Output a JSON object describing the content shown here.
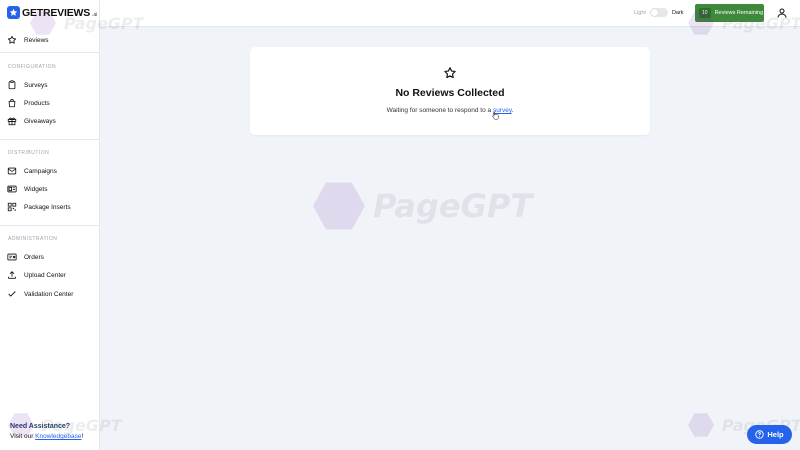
{
  "brand": {
    "name": "GETREVIEWS",
    "suffix": ".ai"
  },
  "sidebar": {
    "top_item": {
      "label": "Reviews",
      "icon": "star-icon"
    },
    "sections": [
      {
        "label": "CONFIGURATION",
        "items": [
          {
            "label": "Surveys",
            "icon": "clipboard-icon"
          },
          {
            "label": "Products",
            "icon": "shopping-bag-icon"
          },
          {
            "label": "Giveaways",
            "icon": "gift-icon"
          }
        ]
      },
      {
        "label": "DISTRIBUTION",
        "items": [
          {
            "label": "Campaigns",
            "icon": "mail-icon"
          },
          {
            "label": "Widgets",
            "icon": "widget-icon"
          },
          {
            "label": "Package Inserts",
            "icon": "qr-code-icon"
          }
        ]
      },
      {
        "label": "ADMINISTRATION",
        "items": [
          {
            "label": "Orders",
            "icon": "receipt-icon"
          },
          {
            "label": "Upload Center",
            "icon": "upload-icon"
          },
          {
            "label": "Validation Center",
            "icon": "check-icon"
          }
        ]
      }
    ],
    "assistance": {
      "title": "Need Assistance?",
      "prefix": "Visit our ",
      "link": "Knowledgebase",
      "suffix": "!"
    }
  },
  "topbar": {
    "theme_light": "Light",
    "theme_dark": "Dark",
    "reviews_remaining_count": "10",
    "reviews_remaining_label": "Reviews Remaining",
    "accent": "#3f8a3a"
  },
  "main": {
    "empty_title": "No Reviews Collected",
    "empty_msg_prefix": "Waiting for someone to respond to a ",
    "empty_msg_link": "survey",
    "empty_msg_suffix": "."
  },
  "watermark": {
    "text": "PageGPT"
  },
  "help": {
    "label": "Help"
  }
}
